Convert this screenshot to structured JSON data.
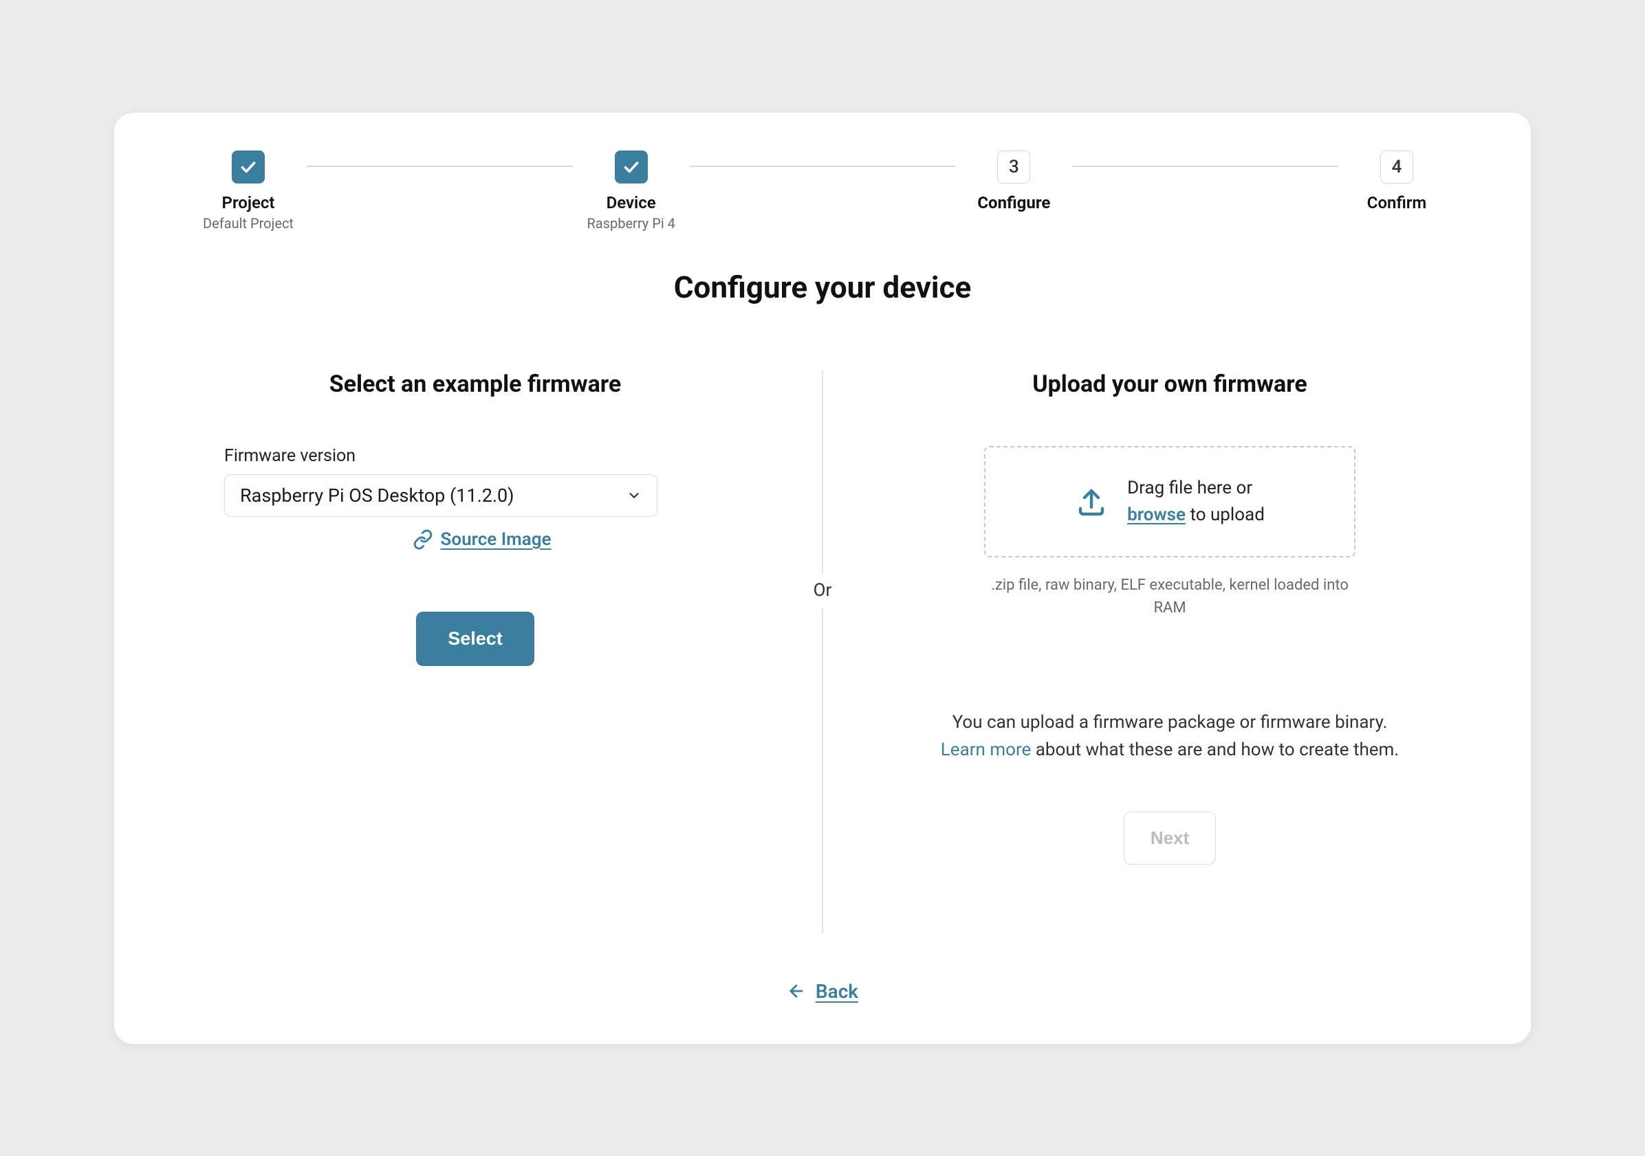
{
  "stepper": {
    "steps": [
      {
        "label": "Project",
        "sub": "Default Project",
        "done": true
      },
      {
        "label": "Device",
        "sub": "Raspberry Pi 4",
        "done": true
      },
      {
        "label": "Configure",
        "sub": "",
        "number": "3",
        "active": true
      },
      {
        "label": "Confirm",
        "sub": "",
        "number": "4"
      }
    ]
  },
  "title": "Configure your device",
  "left": {
    "title": "Select an example firmware",
    "field_label": "Firmware version",
    "selected": "Raspberry Pi OS Desktop (11.2.0)",
    "source_link": "Source Image",
    "select_button": "Select"
  },
  "divider_text": "Or",
  "right": {
    "title": "Upload your own firmware",
    "drop_line1": "Drag file here or",
    "drop_browse": "browse",
    "drop_line2": " to upload",
    "hint": ".zip file, raw binary, ELF executable, kernel loaded into RAM",
    "desc_pre": "You can upload a firmware package or firmware binary. ",
    "desc_link": "Learn more",
    "desc_post": " about what these are and how to create them.",
    "next_button": "Next"
  },
  "back": "Back"
}
